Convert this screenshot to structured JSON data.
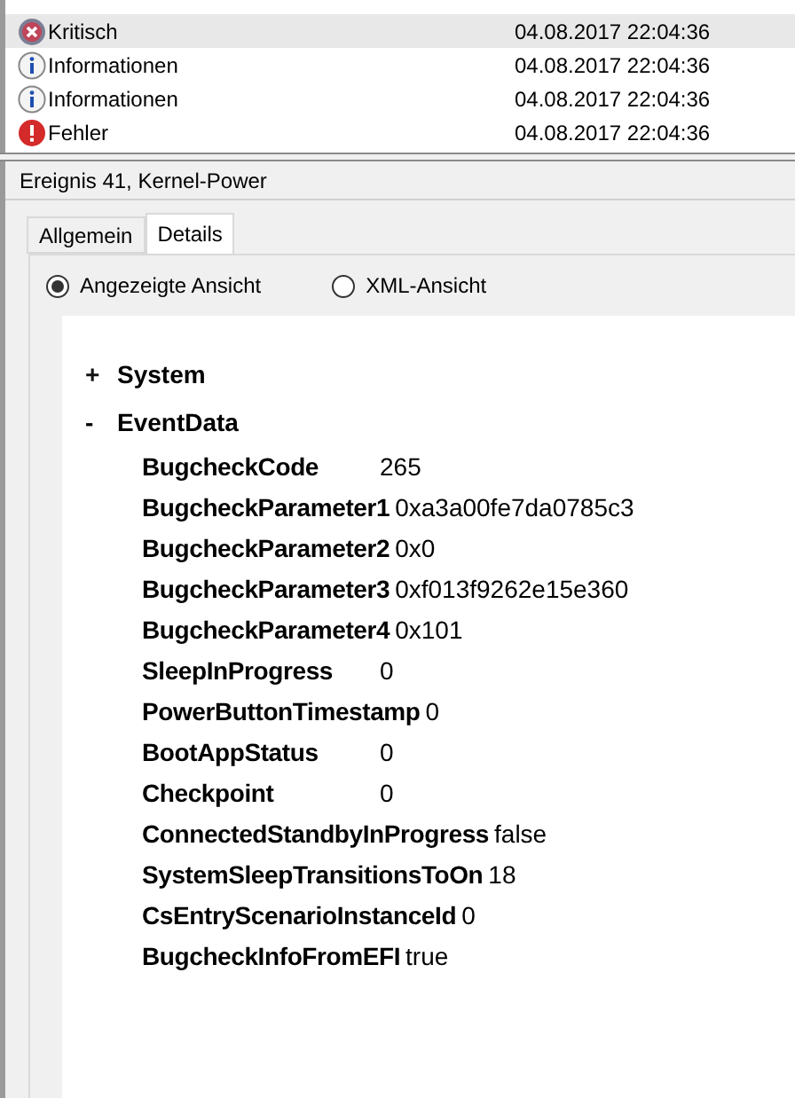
{
  "events": [
    {
      "kind": "critical",
      "level_text": "Kritisch",
      "date": "04.08.2017 22:04:36",
      "selected": true
    },
    {
      "kind": "info",
      "level_text": "Informationen",
      "date": "04.08.2017 22:04:36",
      "selected": false
    },
    {
      "kind": "info",
      "level_text": "Informationen",
      "date": "04.08.2017 22:04:36",
      "selected": false
    },
    {
      "kind": "error",
      "level_text": "Fehler",
      "date": "04.08.2017 22:04:36",
      "selected": false
    }
  ],
  "detail": {
    "title": "Ereignis 41, Kernel-Power",
    "tabs": [
      {
        "label": "Allgemein",
        "selected": false
      },
      {
        "label": "Details",
        "selected": true
      }
    ],
    "views": [
      {
        "label": "Angezeigte Ansicht",
        "selected": true
      },
      {
        "label": "XML-Ansicht",
        "selected": false
      }
    ],
    "tree": [
      {
        "toggle": "+",
        "label": "System",
        "expanded": false
      },
      {
        "toggle": "-",
        "label": "EventData",
        "expanded": true,
        "children": [
          {
            "name": "BugcheckCode",
            "value": "265"
          },
          {
            "name": "BugcheckParameter1",
            "value": "0xa3a00fe7da0785c3"
          },
          {
            "name": "BugcheckParameter2",
            "value": "0x0"
          },
          {
            "name": "BugcheckParameter3",
            "value": "0xf013f9262e15e360"
          },
          {
            "name": "BugcheckParameter4",
            "value": "0x101"
          },
          {
            "name": "SleepInProgress",
            "value": "0"
          },
          {
            "name": "PowerButtonTimestamp",
            "value": "0"
          },
          {
            "name": "BootAppStatus",
            "value": "0"
          },
          {
            "name": "Checkpoint",
            "value": "0"
          },
          {
            "name": "ConnectedStandbyInProgress",
            "value": "false"
          },
          {
            "name": "SystemSleepTransitionsToOn",
            "value": "18"
          },
          {
            "name": "CsEntryScenarioInstanceId",
            "value": "0"
          },
          {
            "name": "BugcheckInfoFromEFI",
            "value": "true"
          }
        ]
      }
    ]
  }
}
